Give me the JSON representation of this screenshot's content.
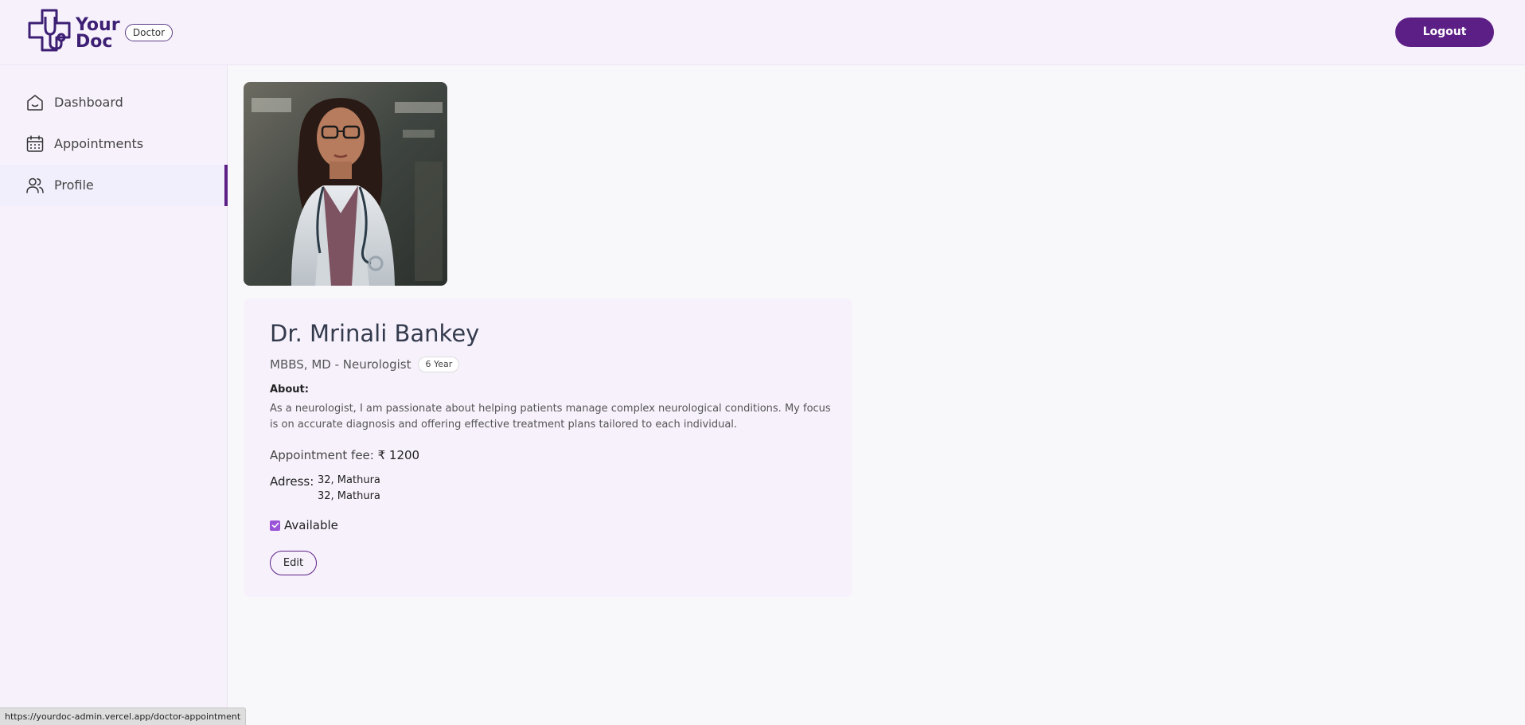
{
  "header": {
    "logo_line1": "Your",
    "logo_line2": "Doc",
    "role_badge": "Doctor",
    "logout_label": "Logout"
  },
  "sidebar": {
    "items": [
      {
        "label": "Dashboard",
        "icon": "home-icon",
        "active": false
      },
      {
        "label": "Appointments",
        "icon": "calendar-icon",
        "active": false
      },
      {
        "label": "Profile",
        "icon": "people-icon",
        "active": true
      }
    ]
  },
  "profile": {
    "name": "Dr. Mrinali Bankey",
    "degree": "MBBS, MD - Neurologist",
    "experience": "6 Year",
    "about_label": "About:",
    "about_text": "As a neurologist, I am passionate about helping patients manage complex neurological conditions. My focus is on accurate diagnosis and offering effective treatment plans tailored to each individual.",
    "fee_label": "Appointment fee:",
    "fee_value": "₹ 1200",
    "address_label": "Adress:",
    "address_line1": "32, Mathura",
    "address_line2": "32, Mathura",
    "available_label": "Available",
    "available": true,
    "edit_label": "Edit"
  },
  "status_bar": {
    "url": "https://yourdoc-admin.vercel.app/doctor-appointment"
  },
  "colors": {
    "brand": "#5c1f85",
    "header_bg": "#f7f1fc",
    "checkbox": "#9a54d8"
  }
}
